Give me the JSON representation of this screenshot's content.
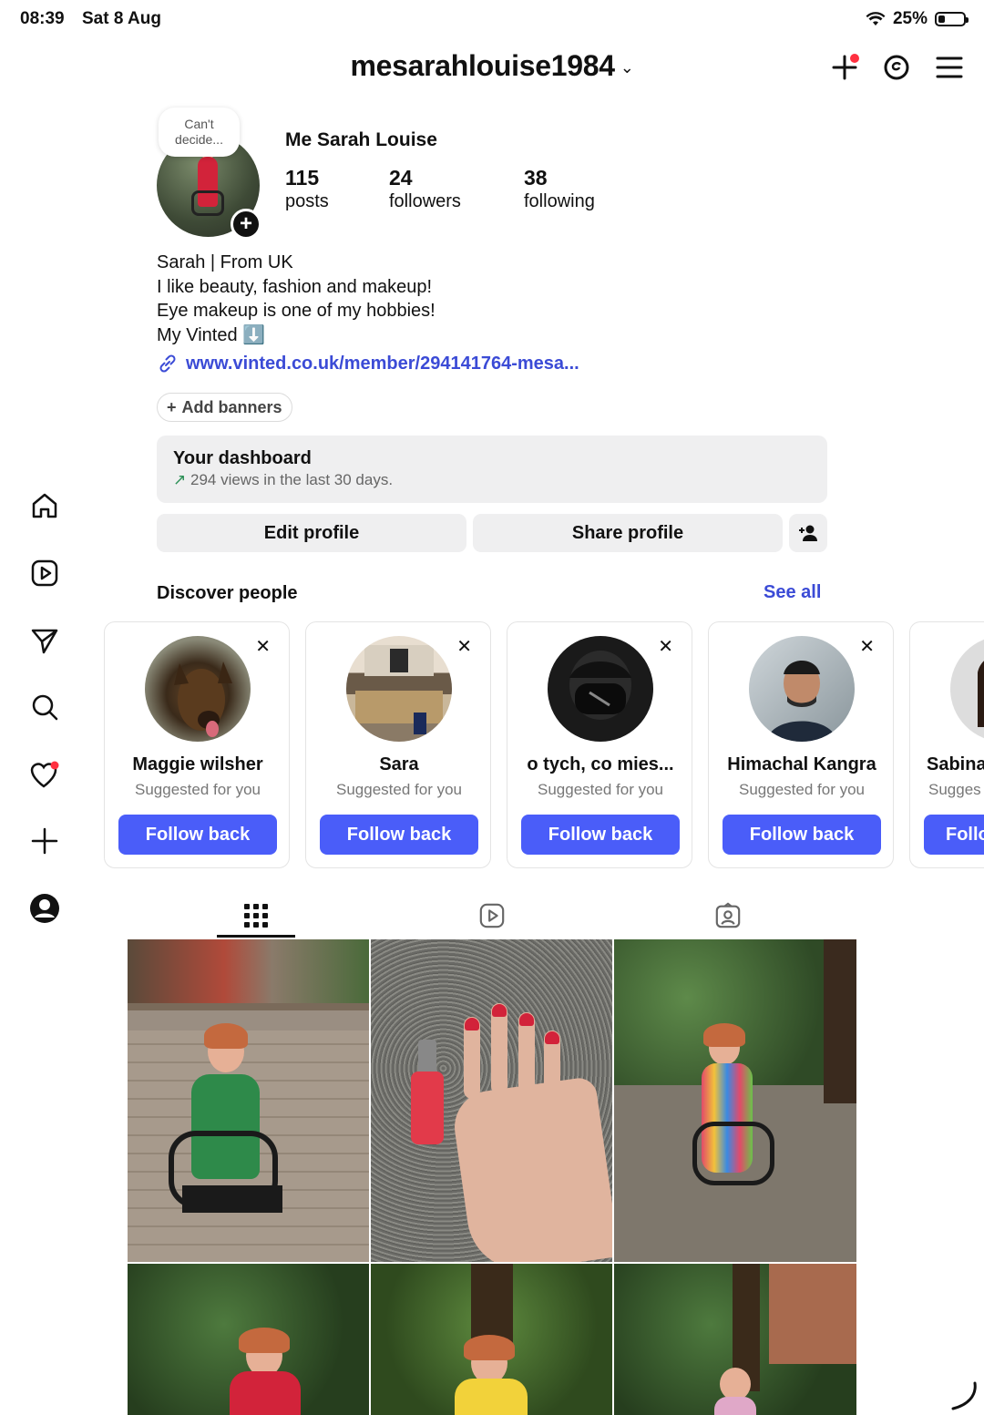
{
  "status_bar": {
    "time": "08:39",
    "date": "Sat 8 Aug",
    "battery": "25%",
    "battery_level": 0.25
  },
  "header": {
    "username": "mesarahlouise1984",
    "icons": [
      "create-icon",
      "threads-icon",
      "menu-icon"
    ]
  },
  "left_rail": [
    "home-icon",
    "reels-icon",
    "direct-icon",
    "search-icon",
    "activity-icon",
    "create-icon",
    "profile-icon"
  ],
  "profile": {
    "note": "Can't decide...",
    "name": "Me Sarah Louise",
    "stats": [
      {
        "value": "115",
        "label": "posts"
      },
      {
        "value": "24",
        "label": "followers"
      },
      {
        "value": "38",
        "label": "following"
      }
    ],
    "bio": [
      "Sarah | From UK",
      "I like beauty, fashion and makeup!",
      "Eye makeup is one of my hobbies!",
      "My Vinted ⬇️"
    ],
    "link": "www.vinted.co.uk/member/294141764-mesa..."
  },
  "add_banners": "Add banners",
  "dashboard": {
    "title": "Your dashboard",
    "subtitle": "294 views in the last 30 days."
  },
  "actions": {
    "edit": "Edit profile",
    "share": "Share profile"
  },
  "discover": {
    "title": "Discover people",
    "see_all": "See all",
    "cards": [
      {
        "name": "Maggie wilsher",
        "sub": "Suggested for you",
        "button": "Follow back"
      },
      {
        "name": "Sara",
        "sub": "Suggested for you",
        "button": "Follow back"
      },
      {
        "name": "o tych, co mies...",
        "sub": "Suggested for you",
        "button": "Follow back"
      },
      {
        "name": "Himachal Kangra",
        "sub": "Suggested for you",
        "button": "Follow back"
      },
      {
        "name": "Sabina",
        "sub": "Sugges",
        "button": "Follo"
      }
    ]
  },
  "tabs": [
    "grid-icon",
    "reels-icon",
    "tagged-icon"
  ],
  "colors": {
    "accent": "#4a5df9",
    "link": "#3b4bd6",
    "notification": "#ff3040"
  }
}
